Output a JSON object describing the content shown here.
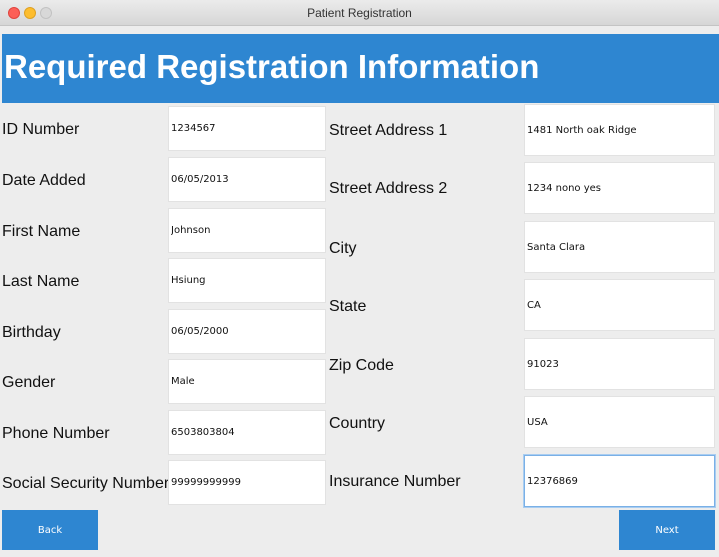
{
  "window": {
    "title": "Patient Registration"
  },
  "header": {
    "title": "Required Registration Information"
  },
  "left_fields": [
    {
      "label": "ID Number",
      "value": "1234567"
    },
    {
      "label": "Date Added",
      "value": "06/05/2013"
    },
    {
      "label": "First Name",
      "value": "Johnson"
    },
    {
      "label": "Last Name",
      "value": "Hsiung"
    },
    {
      "label": "Birthday",
      "value": "06/05/2000"
    },
    {
      "label": "Gender",
      "value": "Male"
    },
    {
      "label": "Phone Number",
      "value": "6503803804"
    },
    {
      "label": "Social Security Number",
      "value": "99999999999"
    }
  ],
  "right_fields": [
    {
      "label": "Street Address 1",
      "value": "1481 North oak Ridge"
    },
    {
      "label": "Street Address 2",
      "value": "1234 nono yes"
    },
    {
      "label": "City",
      "value": "Santa Clara"
    },
    {
      "label": "State",
      "value": "CA"
    },
    {
      "label": "Zip Code",
      "value": "91023"
    },
    {
      "label": "Country",
      "value": "USA"
    },
    {
      "label": "Insurance Number",
      "value": "12376869"
    }
  ],
  "buttons": {
    "back": "Back",
    "next": "Next"
  },
  "colors": {
    "accent": "#2e86d1",
    "background": "#ededed"
  }
}
